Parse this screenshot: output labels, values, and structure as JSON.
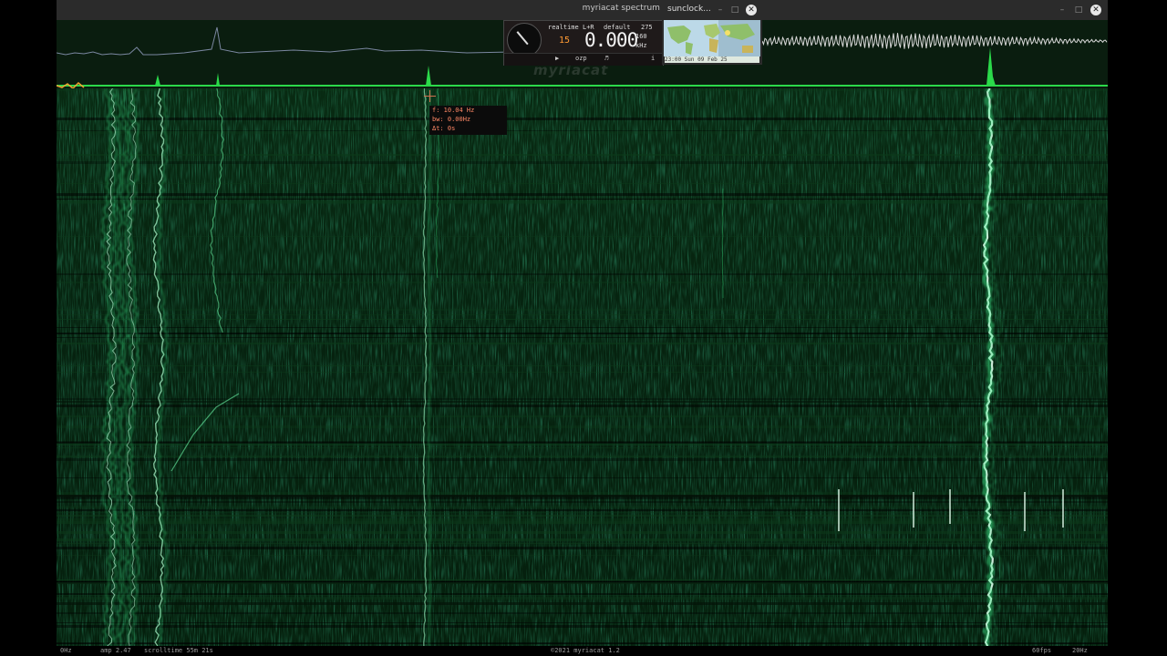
{
  "window": {
    "title": "myriacat spectrum analyzer",
    "minimize_glyph": "–",
    "maximize_glyph": "□",
    "close_glyph": "✕"
  },
  "tuner": {
    "mode": "realtime",
    "channel": "L+R",
    "preset": "default",
    "bins": "275",
    "rate": "160",
    "digit": "15",
    "frequency": "0.000",
    "unit": "kHz",
    "buttons": [
      "▶",
      "ozp",
      "♬",
      "i"
    ]
  },
  "sunclock": {
    "title": "sunclock...",
    "time": "23:00 Sun 09 Feb 25"
  },
  "cursor": {
    "f": "f: 10.04 Hz",
    "bw": "bw: 0.00Hz",
    "dt": "Δt: 0s"
  },
  "status": {
    "left_freq": "0Hz",
    "amp": "amp 2.47",
    "scrolltime": "scrolltime 55m 21s",
    "copyright": "©2021 myriacat 1.2",
    "fps": "60fps",
    "right_freq": "20Hz"
  },
  "watermark": "myriacat",
  "icons": [
    "dial-icon",
    "minimize-icon",
    "maximize-icon",
    "close-icon",
    "play-icon",
    "music-icon",
    "info-icon",
    "crosshair-icon"
  ],
  "colors": {
    "trace": "#29d84a",
    "waterfall_bg": "#062410",
    "signal": "#d8fff0",
    "readout": "#ff8866",
    "digit": "#ff9a33"
  }
}
